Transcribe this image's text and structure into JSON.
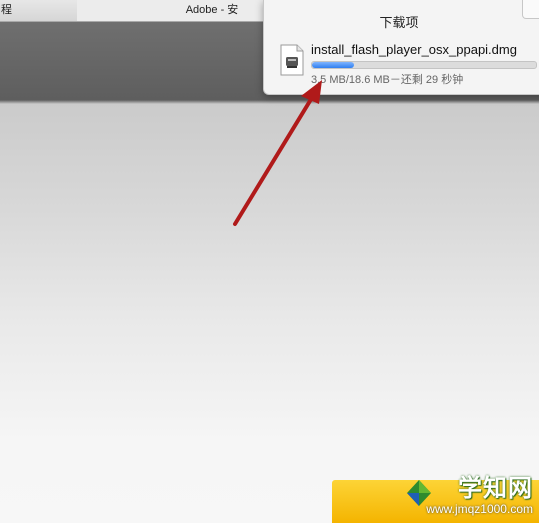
{
  "tabs": [
    {
      "label": "程"
    },
    {
      "label": "Adobe - 安"
    }
  ],
  "downloads": {
    "title": "下载项",
    "file_name": "install_flash_player_osx_ppapi.dmg",
    "progress_fraction": 0.188,
    "status": "3.5 MB/18.6 MB－还剩 29 秒钟"
  },
  "annotation": {
    "arrow_color": "#b01a1a"
  },
  "watermark": {
    "title": "学知网",
    "url": "www.jmqz1000.com"
  },
  "colors": {
    "accent_orange": "#f4b400",
    "progress_blue": "#2f7ff0"
  }
}
